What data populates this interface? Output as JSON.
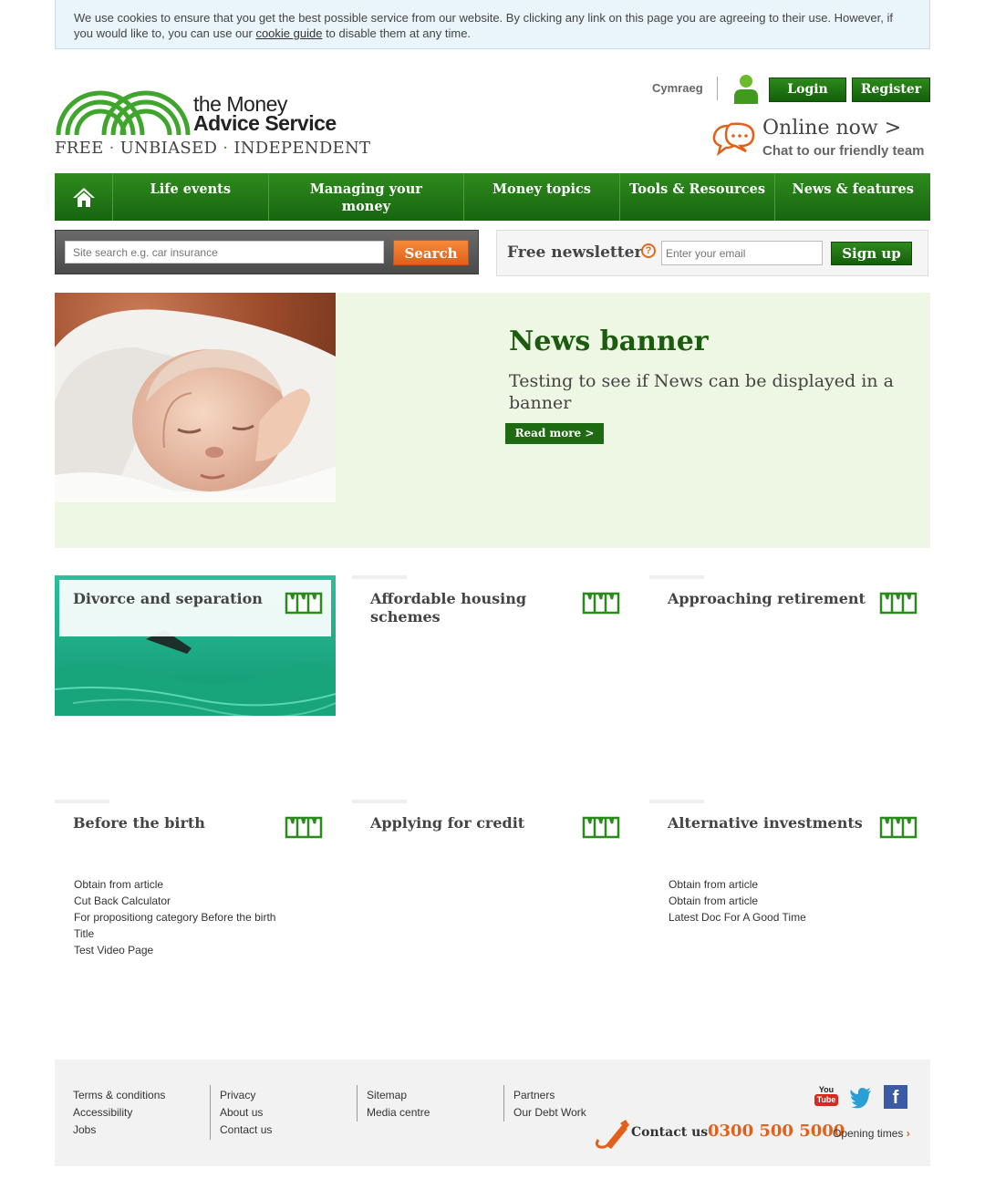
{
  "cookie": {
    "text_before": "We use cookies to ensure that you get the best possible service from our website. By clicking any link on this page you are agreeing to their use. However, if you would like to, you can use our ",
    "link": "cookie guide",
    "text_after": " to disable them at any time."
  },
  "header": {
    "brand_line1": "the Money",
    "brand_line2": "Advice Service",
    "tagline_1": "FREE",
    "tagline_2": "UNBIASED",
    "tagline_3": "INDEPENDENT",
    "tagline_sep": "·",
    "language": "Cymraeg",
    "login": "Login",
    "register": "Register",
    "online_now": "Online now >",
    "chat": "Chat to our friendly team"
  },
  "nav": {
    "items": [
      {
        "label": "Life events"
      },
      {
        "label": "Managing your money"
      },
      {
        "label": "Money topics"
      },
      {
        "label": "Tools & Resources"
      },
      {
        "label": "News & features"
      }
    ]
  },
  "search": {
    "placeholder": "Site search e.g. car insurance",
    "button": "Search"
  },
  "newsletter": {
    "label": "Free newsletter",
    "help": "?",
    "placeholder": "Enter your email",
    "button": "Sign up"
  },
  "banner": {
    "title": "News banner",
    "text": "Testing to see if News can be displayed in a banner",
    "button": "Read more  >"
  },
  "tiles": [
    {
      "title": "Divorce and separation",
      "links": []
    },
    {
      "title": "Affordable housing schemes",
      "links": []
    },
    {
      "title": "Approaching retirement",
      "links": []
    },
    {
      "title": "Before the birth",
      "links": [
        "Obtain from article",
        "Cut Back Calculator",
        "For propositiong category Before the birth",
        "Title",
        "Test Video Page"
      ]
    },
    {
      "title": "Applying for credit",
      "links": []
    },
    {
      "title": "Alternative investments",
      "links": [
        "Obtain from article",
        "Obtain from article",
        "Latest Doc For A Good Time"
      ]
    }
  ],
  "footer": {
    "col1": [
      "Terms & conditions",
      "Accessibility",
      "Jobs"
    ],
    "col2": [
      "Privacy",
      "About us",
      "Contact us"
    ],
    "col3": [
      "Sitemap",
      "Media centre"
    ],
    "col4": [
      "Partners",
      "Our Debt Work"
    ],
    "contact_label": "Contact us",
    "phone": "0300 500 5000",
    "opening": "Opening times",
    "youtube_you": "You",
    "youtube_tube": "Tube",
    "facebook": "f"
  },
  "colors": {
    "brand_green": "#2e8a1c",
    "accent_orange": "#e2601a",
    "banner_bg": "#eef6e4"
  }
}
